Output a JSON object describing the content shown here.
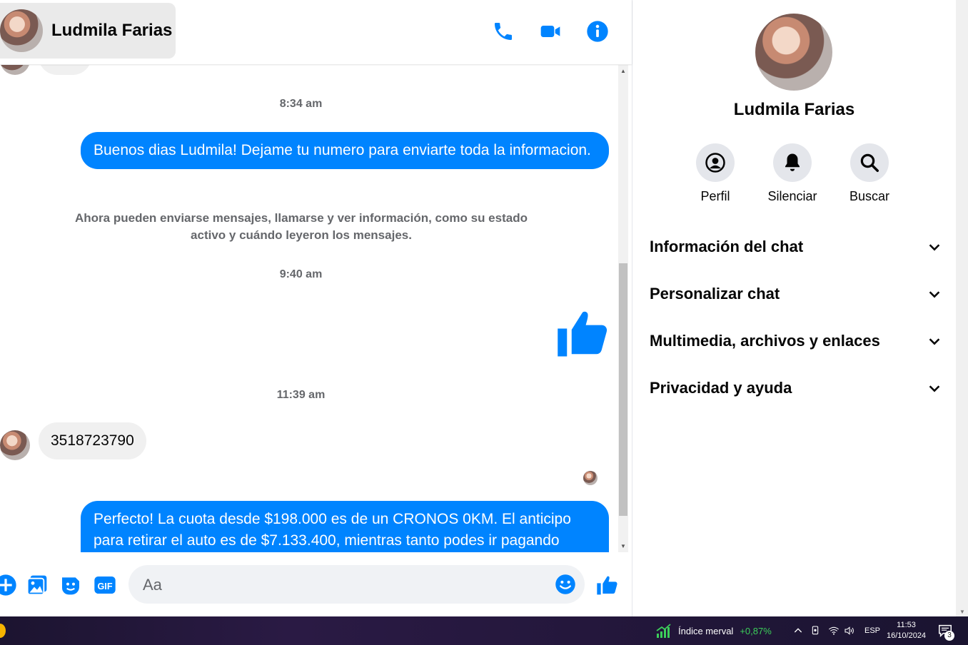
{
  "header": {
    "contact_name": "Ludmila Farias",
    "icons": [
      "phone-icon",
      "video-camera-icon",
      "info-icon"
    ]
  },
  "messages": {
    "timestamps": [
      "8:34 am",
      "9:40 am",
      "11:39 am"
    ],
    "outgoing_1": "Buenos dias Ludmila! Dejame tu numero para enviarte toda la informacion.",
    "notice": "Ahora pueden enviarse mensajes, llamarse y ver información, como su estado activo y cuándo leyeron los mensajes.",
    "incoming_1": "3518723790",
    "outgoing_2": "Perfecto! La cuota desde $198.000 es de un CRONOS 0KM. El anticipo para retirar el auto es de $7.133.400, mientras tanto podes ir pagando"
  },
  "composer": {
    "placeholder": "Aa",
    "tools": [
      "plus-icon",
      "image-icon",
      "sticker-icon",
      "gif-icon",
      "emoji-icon",
      "like-icon"
    ],
    "gif_label": "GIF"
  },
  "sidebar": {
    "name": "Ludmila Farias",
    "actions": [
      {
        "label": "Perfil",
        "icon": "profile-icon"
      },
      {
        "label": "Silenciar",
        "icon": "bell-icon"
      },
      {
        "label": "Buscar",
        "icon": "search-icon"
      }
    ],
    "sections": [
      "Información del chat",
      "Personalizar chat",
      "Multimedia, archivos y enlaces",
      "Privacidad y ayuda"
    ]
  },
  "taskbar": {
    "widget_label": "Índice merval",
    "widget_value": "+0,87%",
    "language": "ESP",
    "time": "11:53",
    "date": "16/10/2024",
    "notifications": "3",
    "colors": {
      "positive": "#3ccf5a"
    }
  },
  "colors": {
    "accent": "#0084ff",
    "incoming_bubble": "#f0f0f0"
  }
}
